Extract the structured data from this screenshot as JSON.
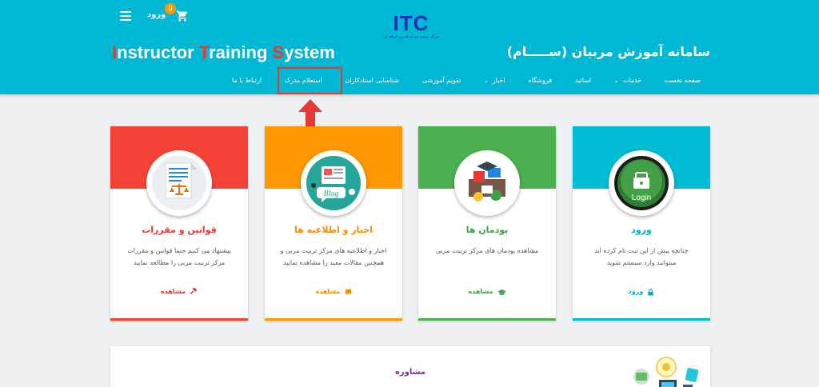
{
  "header": {
    "login_label": "ورود",
    "cart_count": "0",
    "logo_mark": "ITC",
    "logo_subtitle": "مرکز تربیت مربی فنی و حرفه ای",
    "title_en_parts": [
      {
        "init": "I",
        "rest": "nstructor "
      },
      {
        "init": "T",
        "rest": "raining "
      },
      {
        "init": "S",
        "rest": "ystem"
      }
    ],
    "title_fa": "سامانه آموزش مربیان (ســـــام)",
    "colors": {
      "bg": "#00b8d4",
      "accent": "#e53935"
    }
  },
  "nav": {
    "items": [
      {
        "label": "صفحه نخست",
        "dropdown": false
      },
      {
        "label": "خدمات",
        "dropdown": true
      },
      {
        "label": "اساتید",
        "dropdown": false
      },
      {
        "label": "فروشگاه",
        "dropdown": false
      },
      {
        "label": "اخبار",
        "dropdown": true
      },
      {
        "label": "تقویم آموزشی",
        "dropdown": false
      },
      {
        "label": "شناسایی استادکاران",
        "dropdown": false
      },
      {
        "label": "استعلام مدرک",
        "dropdown": false
      },
      {
        "label": "ارتباط با ما",
        "dropdown": false
      }
    ],
    "caret": "⌄"
  },
  "cards": [
    {
      "title": "ورود",
      "desc": "چنانچه پیش از این ثبت نام کرده اید میتوانید وارد سیستم شوید",
      "link": "ورود",
      "link_icon": "lock-icon",
      "image_text": "Login",
      "color": "#00bcd4",
      "title_color": "#00acc1"
    },
    {
      "title": "پودمان ها",
      "desc": "مشاهده پودمان های مرکز تربیت مربی",
      "link": "مشاهده",
      "link_icon": "graduation-cap-icon",
      "color": "#4caf50",
      "title_color": "#43a047"
    },
    {
      "title": "اخبار و اطلاعیه ها",
      "desc": "اخبار و اطلاعیه های مرکز تربیت مربی و همچنین مقالات مفید را مشاهده نمایید",
      "link": "مشاهده",
      "link_icon": "comment-icon",
      "image_text": "Blog",
      "color": "#ff9800",
      "title_color": "#fb8c00"
    },
    {
      "title": "قوانین و مقررات",
      "desc": "پیشنهاد می کنیم حتما قوانین و مقررات مرکز تربیت مربی را مطالعه نمایید",
      "link": "مشاهده",
      "link_icon": "gavel-icon",
      "color": "#f44336",
      "title_color": "#e53935"
    }
  ],
  "consult": {
    "title": "مشاوره"
  }
}
